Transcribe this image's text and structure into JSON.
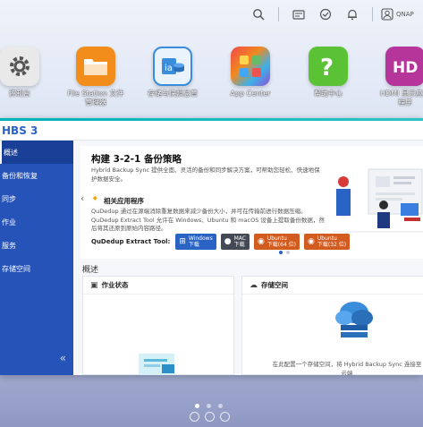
{
  "topbar": {
    "icons": [
      "search-icon",
      "dashboard-icon",
      "task-icon",
      "notification-icon",
      "user-icon"
    ],
    "user_name": "QNAP"
  },
  "apps": [
    {
      "label": "控制台",
      "icon": "gear-icon",
      "color": "#e6e6e6"
    },
    {
      "label": "File Station 文件\n管理器",
      "icon": "folder-icon",
      "color": "#f28c1b"
    },
    {
      "label": "存储与快照总管",
      "icon": "storage-icon",
      "color": "#3a8ddb"
    },
    {
      "label": "App Center",
      "icon": "app-center-icon",
      "color": "#e24b4b"
    },
    {
      "label": "帮助中心",
      "icon": "help-icon",
      "color": "#5bc236"
    },
    {
      "label": "HDMI 显示应用\n程序",
      "icon": "hd-icon",
      "color": "#b5359b"
    }
  ],
  "window": {
    "title": "HBS 3",
    "sidebar": [
      {
        "label": "概述",
        "active": true
      },
      {
        "label": "备份和恢复",
        "active": false
      },
      {
        "label": "同步",
        "active": false
      },
      {
        "label": "作业",
        "active": false
      },
      {
        "label": "服务",
        "active": false
      },
      {
        "label": "存储空间",
        "active": false
      }
    ],
    "collapse_glyph": "«",
    "banner": {
      "title": "构建 3-2-1 备份策略",
      "desc": "Hybrid Backup Sync 提供全面、灵活的备份和同步解决方案，可帮助您轻松、快速地保护数据安全。",
      "sub_title": "相关应用程序",
      "text2": "QuDedup 通过在源端消除重复数据来减少备份大小，并可在传输前进行数据压缩。QuDedup Extract Tool 允许在 Windows、Ubuntu 和 macOS 设备上提取备份数据，然后将其还原到原始内容路径。",
      "dl_label": "QuDedup Extract Tool:",
      "buttons": [
        {
          "os": "Windows",
          "sub": "下载",
          "color": "#2b63c4",
          "glyph": "⊞"
        },
        {
          "os": "MAC",
          "sub": "下载",
          "color": "#444a55",
          "glyph": ""
        },
        {
          "os": "Ubuntu",
          "sub": "下载(64 位)",
          "color": "#d25b1f",
          "glyph": "◉"
        },
        {
          "os": "Ubuntu",
          "sub": "下载(32 位)",
          "color": "#d25b1f",
          "glyph": "◉"
        }
      ]
    },
    "overview_title": "概述",
    "cards": [
      {
        "title": "作业状态",
        "icon": "job-status-icon"
      },
      {
        "title": "存储空间",
        "icon": "storage-space-icon",
        "note": "在此配置一个存储空间，将 Hybrid Backup Sync 连接至云端"
      }
    ]
  }
}
